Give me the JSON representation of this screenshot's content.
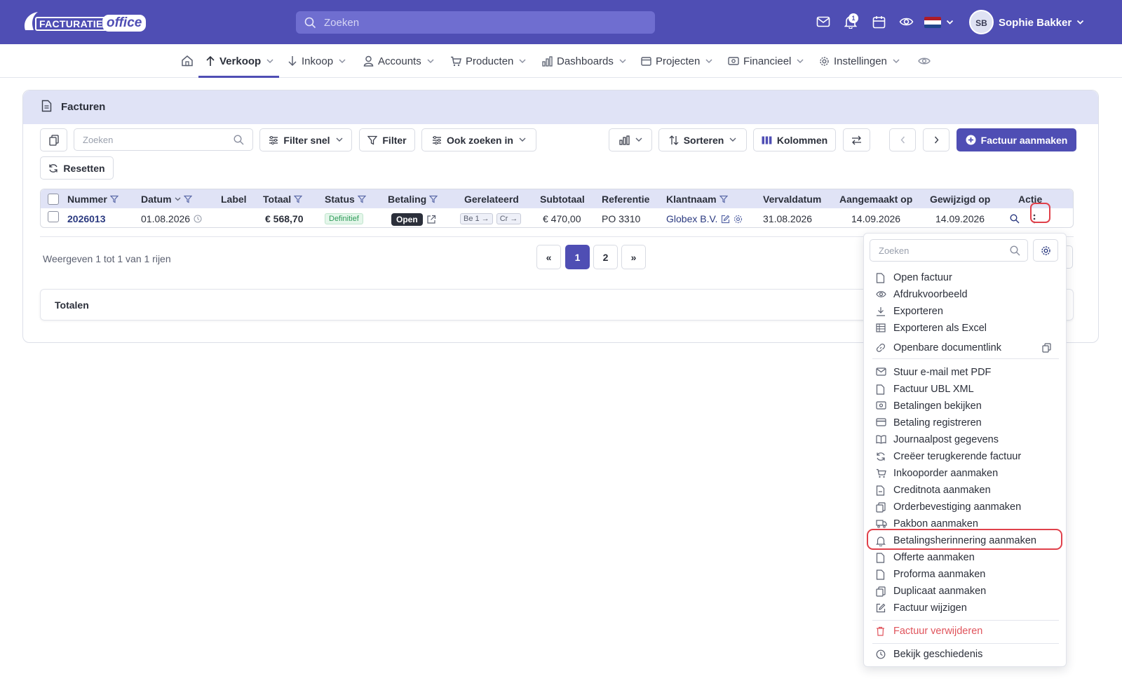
{
  "app": {
    "logo_part1": "FACTURATIE",
    "logo_part2": "office"
  },
  "topbar": {
    "search_placeholder": "Zoeken",
    "notification_count": "1",
    "user_initials": "SB",
    "user_name": "Sophie Bakker",
    "icons": [
      "mail-icon",
      "bell-icon",
      "calendar-icon",
      "eye-icon",
      "flag-nl-icon",
      "chevron-down-icon"
    ]
  },
  "nav": {
    "items": [
      {
        "label": "Verkoop",
        "icon": "arrow-up-icon"
      },
      {
        "label": "Inkoop",
        "icon": "arrow-down-icon"
      },
      {
        "label": "Accounts",
        "icon": "user-icon"
      },
      {
        "label": "Producten",
        "icon": "cart-icon"
      },
      {
        "label": "Dashboards",
        "icon": "bar-chart-icon"
      },
      {
        "label": "Projecten",
        "icon": "folder-icon"
      },
      {
        "label": "Financieel",
        "icon": "money-icon"
      },
      {
        "label": "Instellingen",
        "icon": "gear-icon"
      }
    ]
  },
  "panel": {
    "title": "Facturen"
  },
  "toolbar": {
    "search_placeholder": "Zoeken",
    "filter_quick": "Filter snel",
    "filter": "Filter",
    "also_search": "Ook zoeken in",
    "sort": "Sorteren",
    "columns": "Kolommen",
    "create": "Factuur aanmaken",
    "reset": "Resetten"
  },
  "table": {
    "headers": [
      "Nummer",
      "Datum",
      "Label",
      "Totaal",
      "Status",
      "Betaling",
      "Gerelateerd",
      "Subtotaal",
      "Referentie",
      "Klantnaam",
      "Vervaldatum",
      "Aangemaakt op",
      "Gewijzigd op",
      "Actie"
    ],
    "row": {
      "number": "2026013",
      "date": "01.08.2026",
      "label": "",
      "total": "€ 568,70",
      "status": "Definitief",
      "payment": "Open",
      "related": [
        "Be 1 →",
        "Cr →"
      ],
      "subtotal": "€ 470,00",
      "reference": "PO 3310",
      "customer": "Globex B.V.",
      "due_date": "31.08.2026",
      "created": "14.09.2026",
      "modified": "14.09.2026"
    }
  },
  "footer": {
    "showing": "Weergeven 1 tot 1 van 1 rijen",
    "pages": [
      "«",
      "1",
      "2",
      "»"
    ],
    "active_page": "1"
  },
  "totals": {
    "label": "Totalen"
  },
  "menu": {
    "search_placeholder": "Zoeken",
    "items": [
      {
        "label": "Open factuur",
        "icon": "file-icon"
      },
      {
        "label": "Afdrukvoorbeeld",
        "icon": "eye-icon"
      },
      {
        "label": "Exporteren",
        "icon": "download-icon"
      },
      {
        "label": "Exporteren als Excel",
        "icon": "table-icon"
      },
      {
        "label": "Openbare documentlink",
        "icon": "link-icon"
      },
      {
        "label": "Stuur e-mail met PDF",
        "icon": "mail-icon"
      },
      {
        "label": "Factuur UBL XML",
        "icon": "file-icon"
      },
      {
        "label": "Betalingen bekijken",
        "icon": "money-icon"
      },
      {
        "label": "Betaling registreren",
        "icon": "credit-card-icon"
      },
      {
        "label": "Journaalpost gegevens",
        "icon": "book-icon"
      },
      {
        "label": "Creëer terugkerende factuur",
        "icon": "refresh-icon"
      },
      {
        "label": "Inkooporder aanmaken",
        "icon": "cart-icon"
      },
      {
        "label": "Creditnota aanmaken",
        "icon": "file-minus-icon"
      },
      {
        "label": "Orderbevestiging aanmaken",
        "icon": "files-icon"
      },
      {
        "label": "Pakbon aanmaken",
        "icon": "truck-icon"
      },
      {
        "label": "Betalingsherinnering aanmaken",
        "icon": "bell-icon"
      },
      {
        "label": "Offerte aanmaken",
        "icon": "file-icon"
      },
      {
        "label": "Proforma aanmaken",
        "icon": "file-icon"
      },
      {
        "label": "Duplicaat aanmaken",
        "icon": "copy-icon"
      },
      {
        "label": "Factuur wijzigen",
        "icon": "edit-icon"
      },
      {
        "label": "Factuur verwijderen",
        "icon": "trash-icon"
      },
      {
        "label": "Bekijk geschiedenis",
        "icon": "clock-icon"
      }
    ]
  },
  "colors": {
    "primary": "#4f4eb4",
    "header_bg": "#e0e3f6",
    "danger": "#e0545c",
    "highlight": "#e0414b"
  }
}
